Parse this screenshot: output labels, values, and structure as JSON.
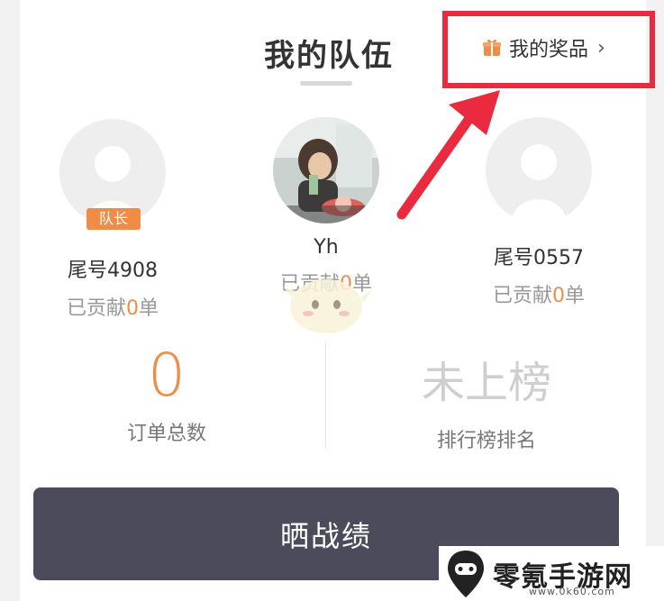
{
  "header": {
    "title": "我的队伍",
    "prize_link_label": "我的奖品",
    "prize_link_chevron": "›"
  },
  "members": [
    {
      "name": "尾号4908",
      "badge": "队长",
      "contrib_prefix": "已贡献",
      "contrib_count": "0",
      "contrib_suffix": "单",
      "avatar": "default-avatar"
    },
    {
      "name": "Yh",
      "badge": "",
      "contrib_prefix": "已贡献",
      "contrib_count": "0",
      "contrib_suffix": "单",
      "avatar": "photo-avatar"
    },
    {
      "name": "尾号0557",
      "badge": "",
      "contrib_prefix": "已贡献",
      "contrib_count": "0",
      "contrib_suffix": "单",
      "avatar": "default-avatar"
    }
  ],
  "stats": {
    "orders_total_value": "0",
    "orders_total_label": "订单总数",
    "rank_value": "未上榜",
    "rank_label": "排行榜排名"
  },
  "share_button_label": "晒战绩",
  "watermark": {
    "text": "零氪手游网",
    "sub": "www.0k60.com"
  },
  "colors": {
    "accent_orange": "#f08c46",
    "highlight_red": "#ea2a3e",
    "button_dark": "#4b4b5c"
  }
}
